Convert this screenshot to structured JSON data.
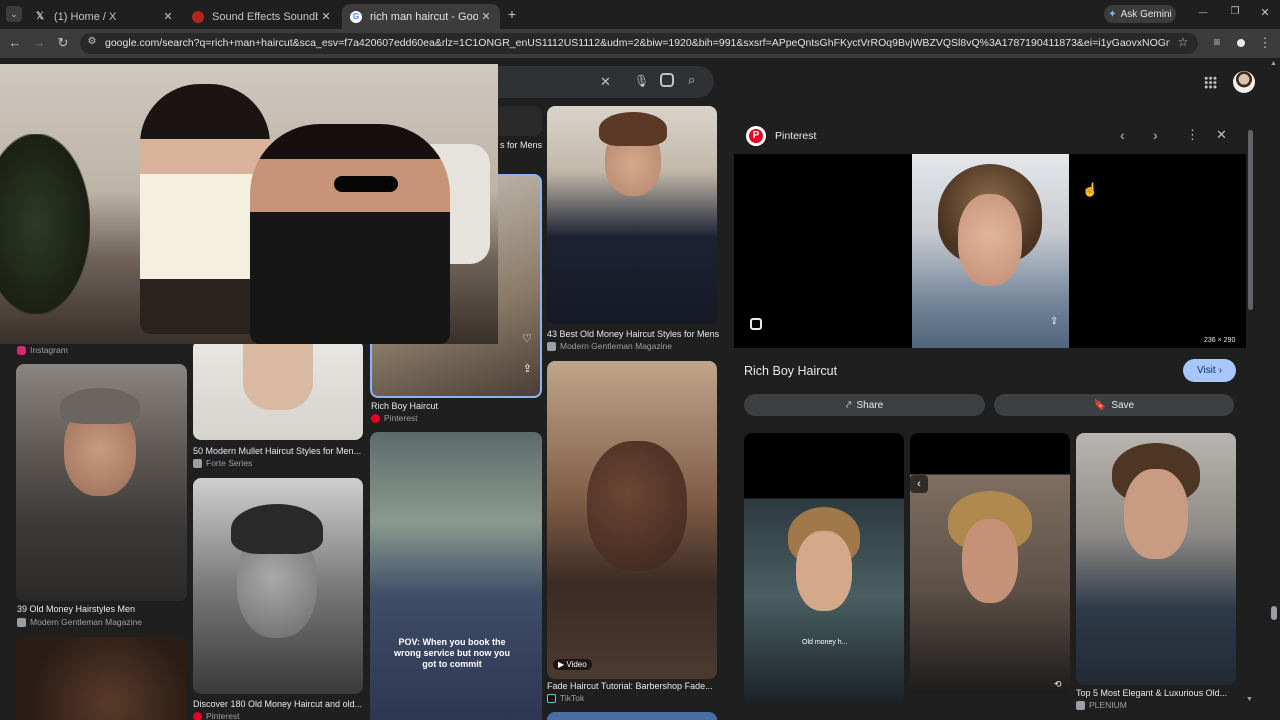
{
  "tabs": [
    {
      "title": "(1) Home / X",
      "icon": "x-logo-icon",
      "close": "✕"
    },
    {
      "title": "Sound Effects Soundboard - Ca",
      "icon": "soundboard-icon",
      "close": "✕"
    },
    {
      "title": "rich man haircut - Google Sear",
      "icon": "google-icon",
      "close": "✕"
    }
  ],
  "new_tab": "+",
  "ask_gemini": "Ask Gemini",
  "window_controls": {
    "minimize": "—",
    "restore": "❐",
    "close": "✕"
  },
  "address": {
    "url": "google.com/search?q=rich+man+haircut&sca_esv=f7a420607edd60ea&rlz=1C1ONGR_enUS1112US1112&udm=2&biw=1920&bih=991&sxsrf=APpeQntsGhFKyctVrROq9BvjWBZVQSl8vQ%3A1787190411873&ei=i1yGaovxNOGnmtkP_o3mQA&oq=&gs_lp=..."
  },
  "results": {
    "col2": [
      {
        "caption": "50 Modern Mullet Haircut Styles for Men...",
        "source": "Forte Series"
      },
      {
        "caption": "Discover 180 Old Money Haircut and old...",
        "source": "Pinterest"
      }
    ],
    "col1": [
      {
        "caption": "",
        "source": "Instagram"
      },
      {
        "caption": "39 Old Money Hairstyles Men",
        "source": "Modern Gentleman Magazine"
      }
    ],
    "col3": [
      {
        "caption": "Rich Boy Haircut",
        "source": "Pinterest",
        "partial": "s for Mens"
      },
      {
        "caption": "",
        "source": "",
        "overlay": "POV: When you book the wrong service but now you got to commit"
      }
    ],
    "col4": [
      {
        "caption": "43 Best Old Money Haircut Styles for Mens",
        "source": "Modern Gentleman Magazine"
      },
      {
        "caption": "Fade Haircut Tutorial: Barbershop Fade...",
        "source": "TikTok",
        "badge": "Video"
      }
    ]
  },
  "panel": {
    "source": "Pinterest",
    "image_size": "236 × 290",
    "title": "Rich Boy Haircut",
    "visit_label": "Visit",
    "share_label": "Share",
    "save_label": "Save",
    "related": [
      {
        "caption": "",
        "overlay": "Old money h..."
      },
      {
        "caption": "",
        "overlay": ""
      },
      {
        "caption": "Top 5 Most Elegant & Luxurious Old...",
        "source": "PLENIUM"
      }
    ]
  },
  "colors": {
    "accent_blue": "#a8c7fa",
    "pinterest_red": "#e60023",
    "instagram_pink": "#d62976"
  }
}
